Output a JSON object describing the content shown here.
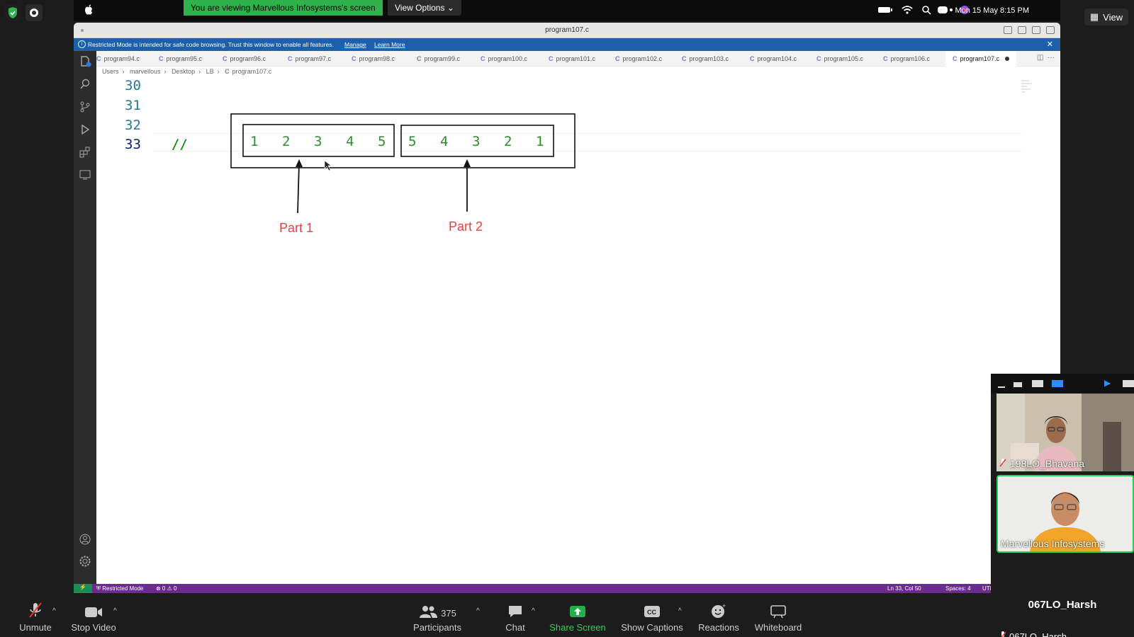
{
  "banner": {
    "viewing": "You are viewing Marvellous Infosystems's screen",
    "view_options": "View Options"
  },
  "clock": "Mon 15 May  8:15 PM",
  "zoom_view_button": "View",
  "window": {
    "title": "program107.c",
    "restricted_notice": "Restricted Mode is intended for safe code browsing. Trust this window to enable all features.",
    "manage_link": "Manage",
    "learn_more_link": "Learn More"
  },
  "tabs": [
    {
      "label": "program94.c"
    },
    {
      "label": "program95.c"
    },
    {
      "label": "program96.c"
    },
    {
      "label": "program97.c"
    },
    {
      "label": "program98.c"
    },
    {
      "label": "program99.c"
    },
    {
      "label": "program100.c"
    },
    {
      "label": "program101.c"
    },
    {
      "label": "program102.c"
    },
    {
      "label": "program103.c"
    },
    {
      "label": "program104.c"
    },
    {
      "label": "program105.c"
    },
    {
      "label": "program106.c"
    },
    {
      "label": "program107.c",
      "active": true
    }
  ],
  "breadcrumb": [
    "Users",
    "marvellous",
    "Desktop",
    "LB",
    "program107.c"
  ],
  "editor": {
    "lines": [
      {
        "no": "30",
        "text": ""
      },
      {
        "no": "31",
        "text": ""
      },
      {
        "no": "32",
        "text": ""
      },
      {
        "no": "33",
        "text": "//"
      }
    ],
    "drawing": {
      "part1_values": [
        "1",
        "2",
        "3",
        "4",
        "5"
      ],
      "part2_values": [
        "5",
        "4",
        "3",
        "2",
        "1"
      ],
      "part1_label": "Part 1",
      "part2_label": "Part 2"
    }
  },
  "statusbar": {
    "restricted": "Restricted Mode",
    "problems": "⊗ 0 ⚠ 0",
    "position": "Ln 33, Col 50",
    "spaces": "Spaces: 4",
    "encoding": "UTI"
  },
  "gallery": {
    "tiles": [
      {
        "name": "198LO_Bhavana",
        "muted": true
      },
      {
        "name": "Marvellous Infosystems",
        "muted": false,
        "active_speaker": true
      }
    ],
    "no_video_name": "067LO_Harsh",
    "no_video_subname": "067LO_Harsh"
  },
  "controls": {
    "unmute": "Unmute",
    "stop_video": "Stop Video",
    "participants": "Participants",
    "participants_count": "375",
    "chat": "Chat",
    "share_screen": "Share Screen",
    "show_captions": "Show Captions",
    "reactions": "Reactions",
    "whiteboard": "Whiteboard"
  },
  "colors": {
    "share_green": "#2fb24a",
    "status_purple": "#6c2c8c",
    "restricted_blue": "#1d5fa8",
    "drawing_green": "#2f8a2f",
    "label_red": "#e84040"
  }
}
